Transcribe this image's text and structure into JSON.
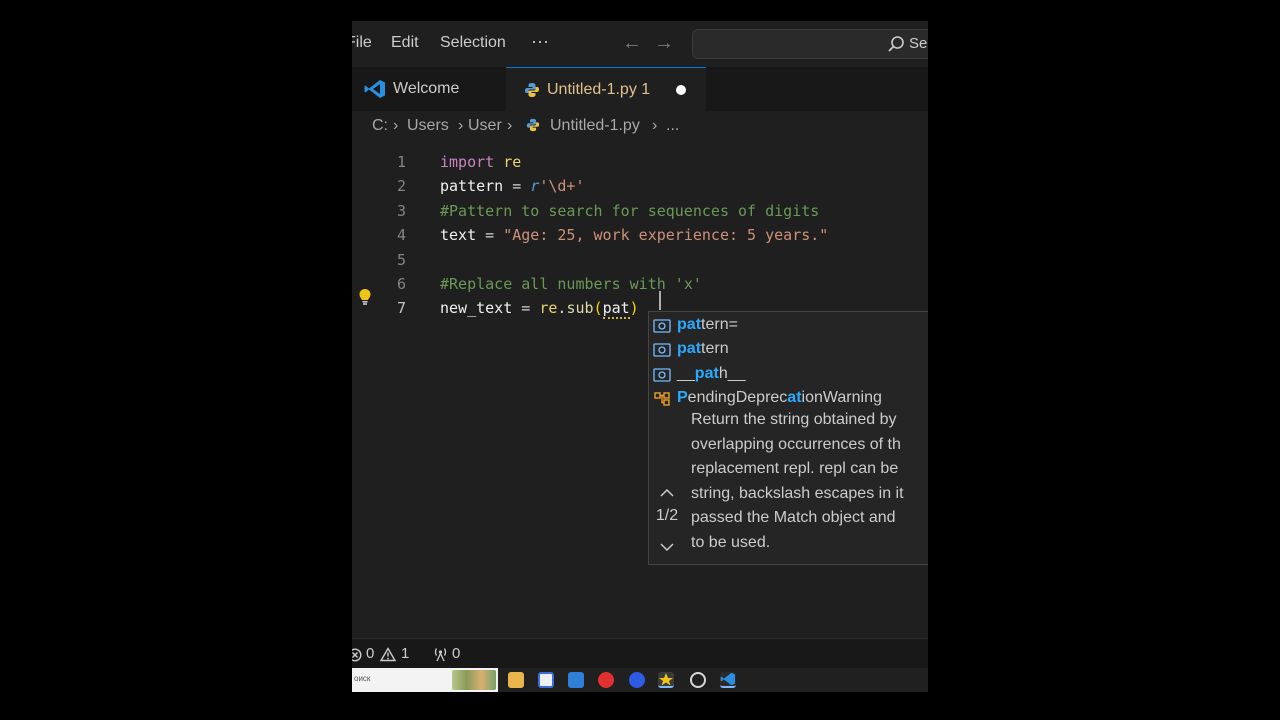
{
  "menu": {
    "items": [
      "File",
      "Edit",
      "Selection"
    ],
    "more": "···",
    "search_placeholder": "Se"
  },
  "tabs": [
    {
      "label": "Welcome",
      "icon": "vscode-logo-icon"
    },
    {
      "label": "Untitled-1.py 1",
      "icon": "python-icon",
      "dirty": true
    }
  ],
  "breadcrumb": [
    "C:",
    "Users",
    "User",
    "Untitled-1.py",
    "..."
  ],
  "editor": {
    "line_numbers": [
      "1",
      "2",
      "3",
      "4",
      "5",
      "6",
      "7"
    ],
    "lines": [
      [
        {
          "t": "import",
          "c": "kw"
        },
        {
          "t": " ",
          "c": "op"
        },
        {
          "t": "re",
          "c": "mod squiggle-none"
        }
      ],
      [
        {
          "t": "pattern",
          "c": "ident"
        },
        {
          "t": " = ",
          "c": "op"
        },
        {
          "t": "r",
          "c": "raw"
        },
        {
          "t": "'\\d+'",
          "c": "str"
        }
      ],
      [
        {
          "t": "#Pattern to search for sequences of digits",
          "c": "comment"
        }
      ],
      [
        {
          "t": "text",
          "c": "ident"
        },
        {
          "t": " = ",
          "c": "op"
        },
        {
          "t": "\"Age: 25, work experience: 5 years.\"",
          "c": "str"
        }
      ],
      [],
      [
        {
          "t": "#Replace all numbers with 'x'",
          "c": "comment"
        }
      ],
      [
        {
          "t": "new_text",
          "c": "ident"
        },
        {
          "t": " = ",
          "c": "op"
        },
        {
          "t": "re",
          "c": "mod"
        },
        {
          "t": ".",
          "c": "op"
        },
        {
          "t": "sub",
          "c": "fn"
        },
        {
          "t": "(",
          "c": "paren"
        },
        {
          "t": "pat",
          "c": "ident squiggle"
        },
        {
          "t": ")",
          "c": "paren"
        }
      ]
    ]
  },
  "suggestions": [
    {
      "label": "pattern=",
      "match": "pat",
      "icon": "variable-icon"
    },
    {
      "label": "pattern",
      "match": "pat",
      "icon": "variable-icon"
    },
    {
      "label": "__path__",
      "match": "pat",
      "icon": "variable-icon"
    },
    {
      "label": "PendingDeprecationWarning",
      "match": "pat",
      "icon": "class-icon"
    }
  ],
  "signature_help": {
    "counter": "1/2",
    "doc_lines": [
      "Return the string obtained by",
      "overlapping occurrences of th",
      "replacement repl. repl can be",
      "string, backslash escapes in it",
      "passed the Match object and",
      "to be used."
    ]
  },
  "status": {
    "errors": "0",
    "warnings": "1",
    "ports": "0"
  },
  "taskbar": {
    "search_text": "оиск"
  },
  "colors": {
    "accent": "#0078d4",
    "keyword": "#c586c0",
    "string": "#ce9178",
    "comment": "#6a9955",
    "match_highlight": "#2aaaff"
  }
}
